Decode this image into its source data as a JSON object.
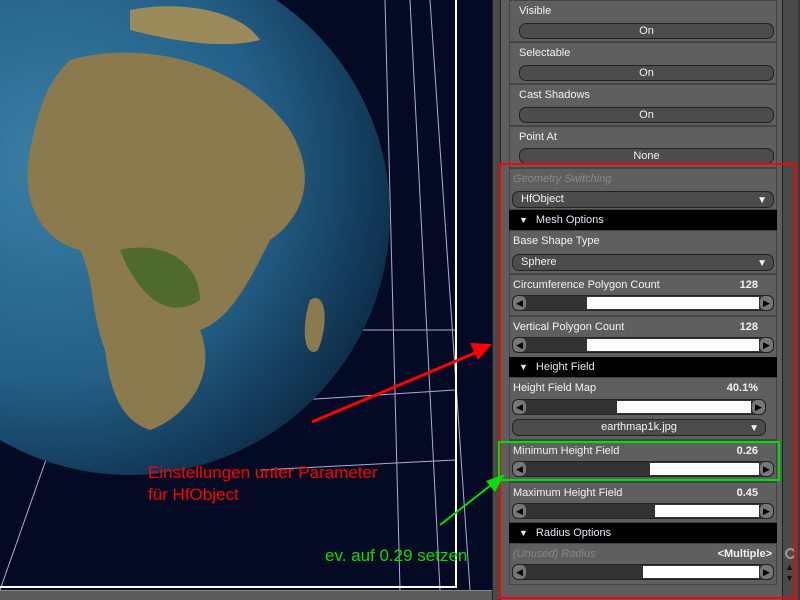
{
  "panel": {
    "visible": {
      "label": "Visible",
      "value": "On"
    },
    "selectable": {
      "label": "Selectable",
      "value": "On"
    },
    "cast_shadows": {
      "label": "Cast Shadows",
      "value": "On"
    },
    "point_at": {
      "label": "Point At",
      "value": "None"
    },
    "geometry_switching": {
      "label": "Geometry Switching",
      "value": "HfObject"
    },
    "mesh_options": {
      "label": "Mesh Options"
    },
    "base_shape_type": {
      "label": "Base Shape Type",
      "value": "Sphere"
    },
    "circumference": {
      "label": "Circumference Polygon Count",
      "value": "128",
      "fraction": 0.26
    },
    "vertical": {
      "label": "Vertical Polygon Count",
      "value": "128",
      "fraction": 0.26
    },
    "height_field": {
      "label": "Height Field"
    },
    "height_field_map": {
      "label": "Height Field Map",
      "value": "40.1%",
      "fraction": 0.401,
      "file": "earthmap1k.jpg"
    },
    "min_height": {
      "label": "Minimum Height Field",
      "value": "0.26",
      "fraction": 0.53
    },
    "max_height": {
      "label": "Maximum Height Field",
      "value": "0.45",
      "fraction": 0.55
    },
    "radius_options": {
      "label": "Radius Options"
    },
    "radius": {
      "label": "(Unused) Radius",
      "value": "<Multiple>",
      "fraction": 0.5
    }
  },
  "annotations": {
    "red_note_line1": "Einstellungen unter Parameter",
    "red_note_line2": "für HfObject",
    "green_note": "ev. auf 0.29 setzen",
    "red_color": "#ff0000",
    "green_color": "#00e000"
  }
}
